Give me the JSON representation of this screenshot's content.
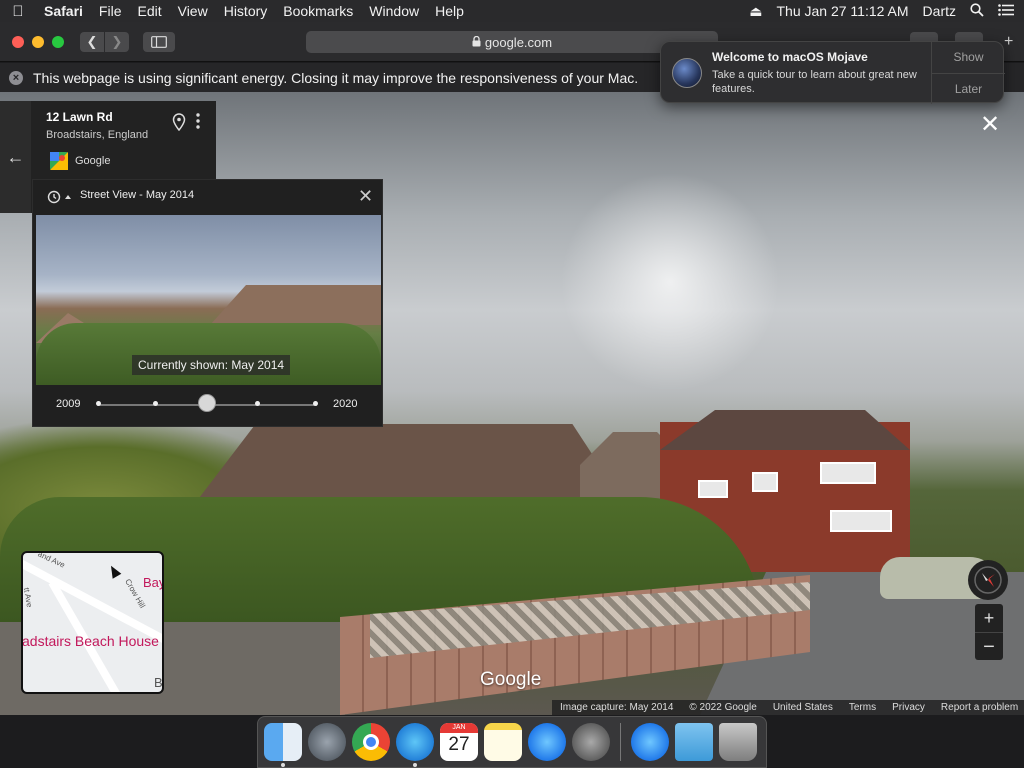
{
  "menubar": {
    "app_name": "Safari",
    "items": [
      "File",
      "Edit",
      "View",
      "History",
      "Bookmarks",
      "Window",
      "Help"
    ],
    "clock": "Thu Jan 27  11:12 AM",
    "user": "Dartz"
  },
  "toolbar": {
    "url": "google.com"
  },
  "energy_warning": {
    "text": "This webpage is using significant energy. Closing it may improve the responsiveness of your Mac."
  },
  "place_card": {
    "title": "12 Lawn Rd",
    "subtitle": "Broadstairs, England",
    "source": "Google"
  },
  "time_panel": {
    "title": "Street View - May 2014",
    "caption": "Currently shown: May 2014",
    "start_year": "2009",
    "end_year": "2020",
    "selected_position": 0.5
  },
  "minimap": {
    "label_bay": "Bay",
    "label_beach": "adstairs Beach House",
    "label_b": "B",
    "street_1": "and Ave",
    "street_2": "Crow Hill",
    "street_3": "tt Ave"
  },
  "watermark": "Google",
  "footer": {
    "capture": "Image capture: May 2014",
    "copyright": "© 2022 Google",
    "region": "United States",
    "terms": "Terms",
    "privacy": "Privacy",
    "report": "Report a problem"
  },
  "notification": {
    "title": "Welcome to macOS Mojave",
    "body": "Take a quick tour to learn about great new features.",
    "show_label": "Show",
    "later_label": "Later"
  },
  "dock": {
    "calendar_month": "JAN",
    "calendar_day": "27"
  },
  "colors": {
    "menubar_bg": "#2a2a2c",
    "brand_pink": "#c2185b",
    "traffic_red": "#fe5f57",
    "traffic_yellow": "#febc2e",
    "traffic_green": "#28c840"
  }
}
